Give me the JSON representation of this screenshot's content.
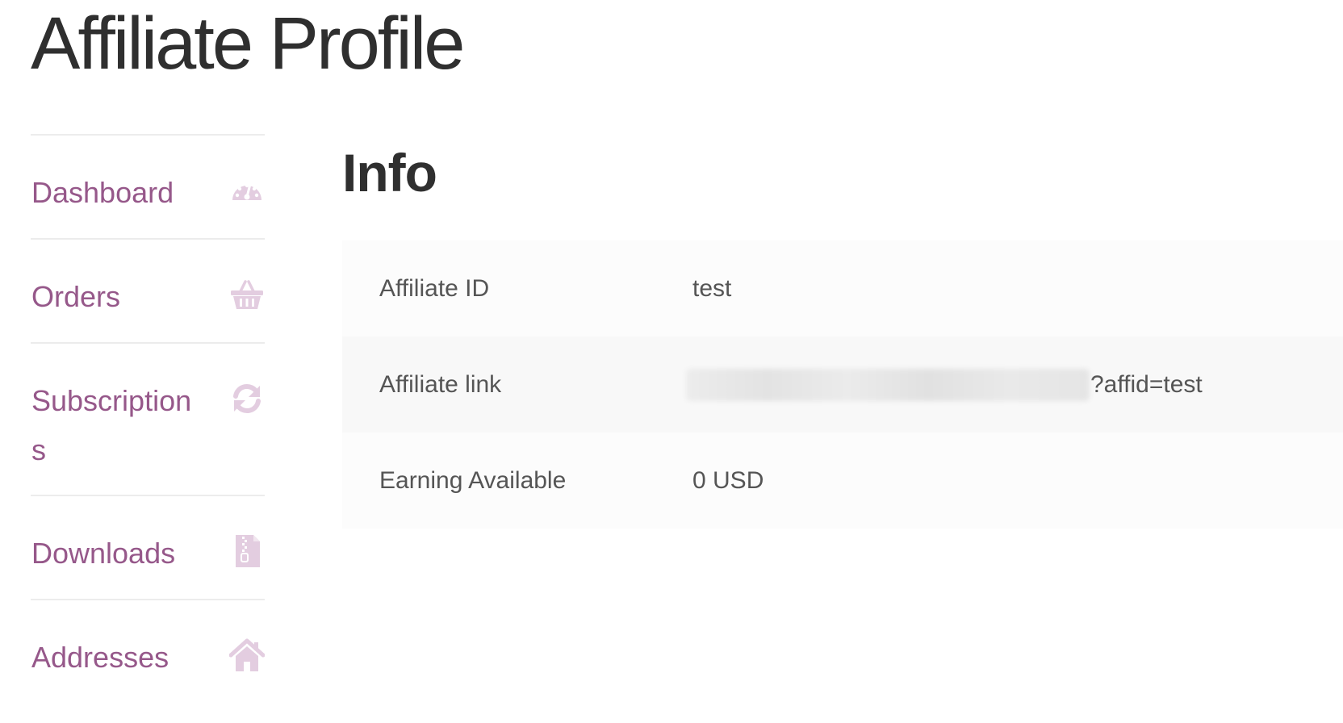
{
  "page": {
    "title": "Affiliate Profile"
  },
  "sidebar": {
    "items": [
      {
        "label": "Dashboard",
        "icon": "dashboard-gauge-icon"
      },
      {
        "label": "Orders",
        "icon": "basket-icon"
      },
      {
        "label": "Subscriptions",
        "icon": "refresh-icon"
      },
      {
        "label": "Downloads",
        "icon": "file-archive-icon"
      },
      {
        "label": "Addresses",
        "icon": "home-icon"
      }
    ]
  },
  "info": {
    "title": "Info",
    "rows": [
      {
        "label": "Affiliate ID",
        "value": "test"
      },
      {
        "label": "Affiliate link",
        "value_suffix": "?affid=test"
      },
      {
        "label": "Earning Available",
        "value": "0 USD"
      }
    ]
  },
  "colors": {
    "link": "#96588a",
    "icon": "#e3cde0",
    "divider": "#ececec"
  }
}
